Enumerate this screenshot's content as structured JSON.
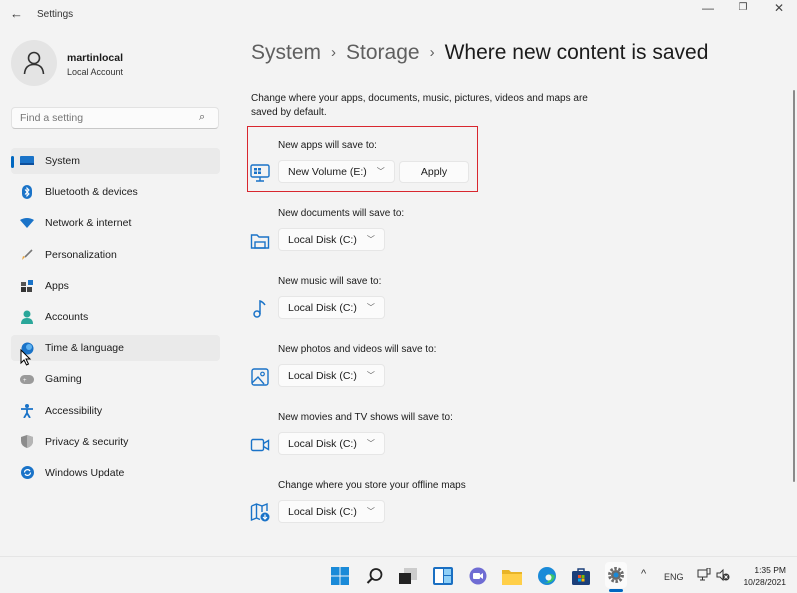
{
  "window": {
    "title": "Settings",
    "controls": {
      "minimize": "—",
      "maximize": "❐",
      "close": "✕"
    }
  },
  "account": {
    "name": "martinlocal",
    "type": "Local Account"
  },
  "search": {
    "placeholder": "Find a setting"
  },
  "sidebar": {
    "items": [
      {
        "label": "System",
        "icon": "system-icon",
        "selected": true
      },
      {
        "label": "Bluetooth & devices",
        "icon": "bluetooth-icon"
      },
      {
        "label": "Network & internet",
        "icon": "wifi-icon"
      },
      {
        "label": "Personalization",
        "icon": "brush-icon"
      },
      {
        "label": "Apps",
        "icon": "apps-icon"
      },
      {
        "label": "Accounts",
        "icon": "person-icon"
      },
      {
        "label": "Time & language",
        "icon": "globe-clock-icon",
        "hover": true
      },
      {
        "label": "Gaming",
        "icon": "gamepad-icon"
      },
      {
        "label": "Accessibility",
        "icon": "accessibility-icon"
      },
      {
        "label": "Privacy & security",
        "icon": "shield-icon"
      },
      {
        "label": "Windows Update",
        "icon": "update-icon"
      }
    ]
  },
  "breadcrumb": {
    "items": [
      "System",
      "Storage"
    ],
    "current": "Where new content is saved",
    "separator": "›"
  },
  "description": "Change where your apps, documents, music, pictures, videos and maps are saved by default.",
  "settings": [
    {
      "label": "New apps will save to:",
      "value": "New Volume (E:)",
      "icon": "apps-monitor-icon",
      "apply": "Apply"
    },
    {
      "label": "New documents will save to:",
      "value": "Local Disk (C:)",
      "icon": "documents-folder-icon"
    },
    {
      "label": "New music will save to:",
      "value": "Local Disk (C:)",
      "icon": "music-note-icon"
    },
    {
      "label": "New photos and videos will save to:",
      "value": "Local Disk (C:)",
      "icon": "photo-icon"
    },
    {
      "label": "New movies and TV shows will save to:",
      "value": "Local Disk (C:)",
      "icon": "video-camera-icon"
    },
    {
      "label": "Change where you store your offline maps",
      "value": "Local Disk (C:)",
      "icon": "map-download-icon"
    }
  ],
  "taskbar": {
    "apps": [
      "start",
      "search",
      "task-view",
      "widgets",
      "teams-chat",
      "file-explorer",
      "edge",
      "store",
      "settings"
    ],
    "tray": {
      "chevron": "^",
      "language": "ENG"
    },
    "time": "1:35 PM",
    "date": "10/28/2021"
  },
  "colors": {
    "accent": "#0067c0",
    "highlight_box": "#d8262e",
    "icon_blue": "#1a73c8"
  }
}
